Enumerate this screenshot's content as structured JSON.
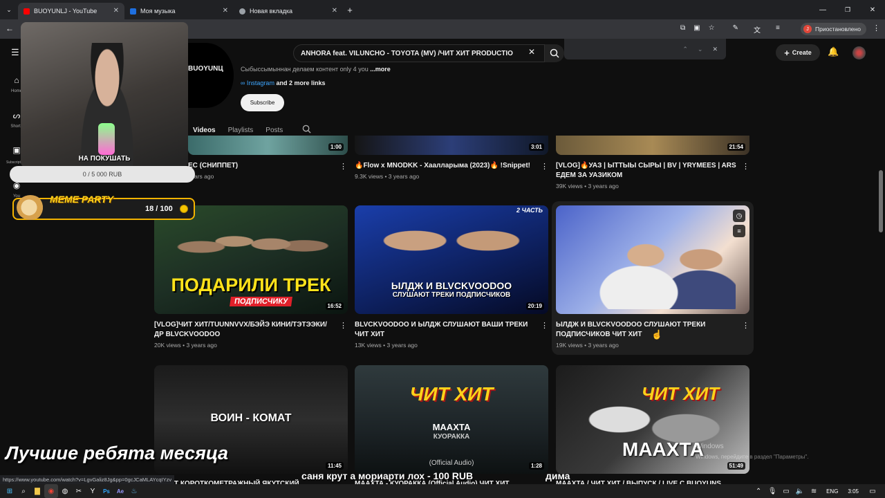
{
  "browser": {
    "tabs": [
      {
        "title": "BUOYUNLJ - YouTube",
        "color": "#ff0000"
      },
      {
        "title": "Моя музыка",
        "color": "#1e6fe0"
      },
      {
        "title": "Новая вкладка",
        "color": "#9aa0a6"
      }
    ],
    "profile_label": "Приостановлено",
    "profile_initial": "J"
  },
  "youtube": {
    "search_value": "ANHORA feat. VILUNCHO - TOYOTA (MV) /ЧИТ ХИТ PRODUCTIO",
    "create_label": "Create",
    "sidebar": [
      {
        "label": "Home"
      },
      {
        "label": "Shorts"
      },
      {
        "label": "Subscriptions"
      },
      {
        "label": "You"
      }
    ],
    "channel": {
      "name_fragment": "BUOYUNЦ",
      "description": "Сыбыссымыннан делаем контент only 4 you",
      "more_label": "...more",
      "link_label": "Instagram",
      "more_links": "and 2 more links",
      "subscribe_label": "Subscribe"
    },
    "tabs": [
      {
        "label": "Videos"
      },
      {
        "label": "Playlists"
      },
      {
        "label": "Posts"
      }
    ],
    "videos": [
      {
        "title": "ЕС (СНИППЕТ)",
        "meta": "years ago",
        "duration": "1:00"
      },
      {
        "title": "🔥Flow x MNODKK - Хаалларыма (2023)🔥 !Snippet!",
        "meta": "9.3K views • 3 years ago",
        "duration": "3:01"
      },
      {
        "title": "[VLOG]🔥УАЗ | ЫТТЫЫ СЫРЫ | BV | YRYMEES | ARS ЕДЕМ ЗА УАЗИКОМ",
        "meta": "39K views • 3 years ago",
        "duration": "21:54"
      },
      {
        "title": "[VLOG]ЧИТ ХИТ/TUUNNVVX/БЭЙЭ КИНИ/ТЭТЭЭКИ/ДР BLVCKVOODOO",
        "meta": "20K views • 3 years ago",
        "duration": "16:52",
        "thumb_text": "ПОДАРИЛИ ТРЕК",
        "thumb_sub": "ПОДПИСЧИКУ"
      },
      {
        "title": "BLVCKVOODOO И ЫЛДЖ СЛУШАЮТ ВАШИ ТРЕКИ ЧИТ ХИТ",
        "meta": "13K views • 3 years ago",
        "duration": "20:19",
        "thumb_text": "ЫЛДЖ И BLVCKVOODOO",
        "thumb_sub": "СЛУШАЮТ ТРЕКИ ПОДПИСЧИКОВ",
        "thumb_corner": "2 ЧАСТЬ"
      },
      {
        "title": "ЫЛДЖ И BLVCKVOODOO СЛУШАЮТ ТРЕКИ ПОДПИСЧИКОВ ЧИТ ХИТ",
        "meta": "19K views • 3 years ago"
      },
      {
        "title": "КОМАТ КОРОТКОМЕТРАЖНЫЙ ЯКУТСКИЙ",
        "duration": "11:45",
        "thumb_text": "ВОИН - КОМАТ"
      },
      {
        "title": "МААХТА - КУОРАККА (Official Audio) ЧИТ ХИТ",
        "duration": "1:28",
        "thumb_text": "ЧИТ ХИТ",
        "thumb_mid": "МААХТА",
        "thumb_sub": "КУОРАККА",
        "thumb_bottom": "(Official Audio)"
      },
      {
        "title": "МААХТА / ЧИТ ХИТ / ВЫПУСК / LIVE С BUOYUNS",
        "duration": "51:49",
        "thumb_text": "ЧИТ ХИТ",
        "thumb_mid": "МААХТА"
      }
    ]
  },
  "stream_overlay": {
    "donation_label": "НА ПОКУШАТЬ",
    "donation_progress": "0 / 5 000 RUB",
    "donation_fraction": 0,
    "meme_title": "MEME PARTY",
    "meme_progress": "18 / 100",
    "caption": "Лучшие ребята месяца",
    "ticker": "саня крут а мориарти лох - 100 RUB",
    "ticker2": "дима"
  },
  "windows": {
    "activation_title": "Windows",
    "activation_text": "Windows, перейдите в раздел \"Параметры\".",
    "lang": "ENG",
    "time": "3:05"
  },
  "status_url": "https://www.youtube.com/watch?v=LgvGaliz8Jg&pp=0gcJCaMLAYcqIYzv"
}
